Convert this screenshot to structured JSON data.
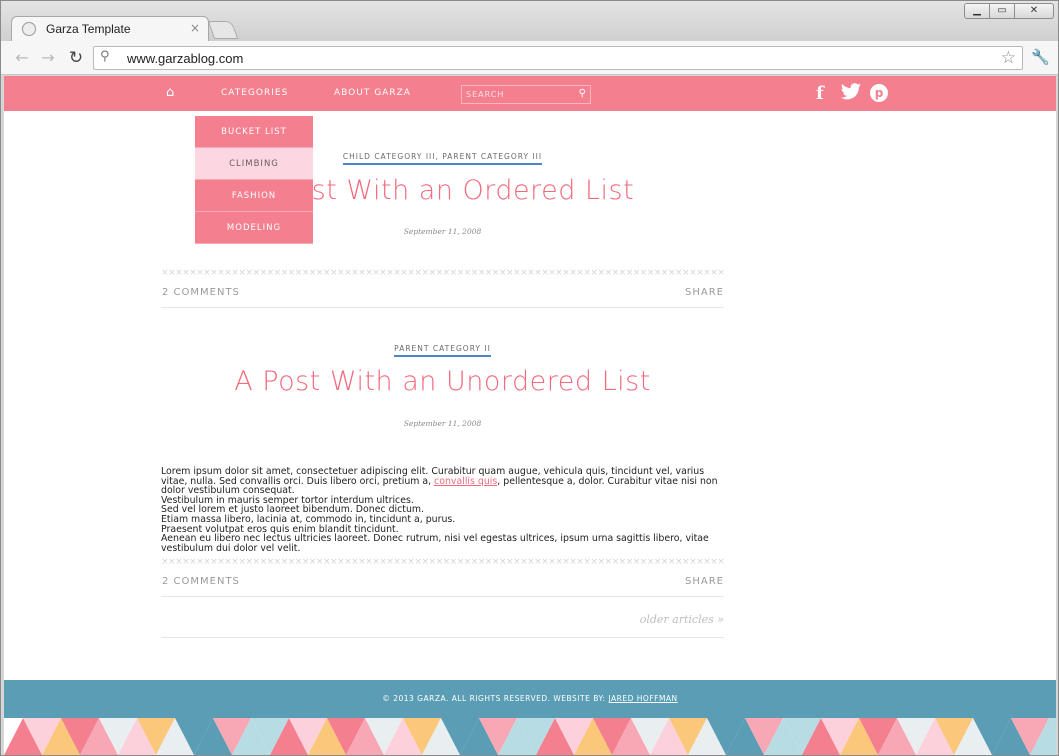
{
  "browser": {
    "tab_title": "Garza Template",
    "tab_close": "×",
    "url": "www.garzablog.com",
    "window_buttons": {
      "minimize": "▁",
      "maximize": "▭",
      "close": "✕"
    }
  },
  "nav": {
    "home_icon": "⌂",
    "categories": "CATEGORIES",
    "about": "ABOUT GARZA",
    "search_placeholder": "SEARCH",
    "search_icon": "⚲",
    "social": {
      "facebook": "f",
      "twitter": "t",
      "pinterest": "p"
    }
  },
  "dropdown": {
    "items": [
      "BUCKET LIST",
      "CLIMBING",
      "FASHION",
      "MODELING"
    ]
  },
  "posts": [
    {
      "categories": "CHILD CATEGORY III, PARENT CATEGORY III",
      "title": "A Post With an Ordered List",
      "date": "September 11, 2008",
      "comments": "2 COMMENTS",
      "share": "SHARE"
    },
    {
      "categories": "PARENT CATEGORY II",
      "title": "A Post With an Unordered List",
      "date": "September 11, 2008",
      "body_1": "Lorem ipsum dolor sit amet, consectetuer adipiscing elit. Curabitur quam augue, vehicula quis, tincidunt vel, varius vitae, nulla. Sed convallis orci. Duis libero orci, pretium a, ",
      "body_link": "convallis quis",
      "body_2": ", pellentesque a, dolor. Curabitur vitae nisi non dolor vestibulum consequat.",
      "body_lines": [
        "Vestibulum in mauris semper tortor interdum ultrices.",
        "Sed vel lorem et justo laoreet bibendum. Donec dictum.",
        "Etiam massa libero, lacinia at, commodo in, tincidunt a, purus.",
        "Praesent volutpat eros quis enim blandit tincidunt.",
        "Aenean eu libero nec lectus ultricies laoreet. Donec rutrum, nisi vel egestas ultrices, ipsum urna sagittis libero, vitae vestibulum dui dolor vel velit."
      ],
      "comments": "2 COMMENTS",
      "share": "SHARE"
    }
  ],
  "older": "older articles »",
  "footer": {
    "text": "© 2013 GARZA. ALL RIGHTS RESERVED. WEBSITE BY: ",
    "link": "JARED HOFFMAN"
  },
  "colors": {
    "brand_pink": "#f47f8f",
    "title_pink": "#f26a7d",
    "footer_blue": "#5b9db5",
    "category_underline": "#4b86c7"
  }
}
